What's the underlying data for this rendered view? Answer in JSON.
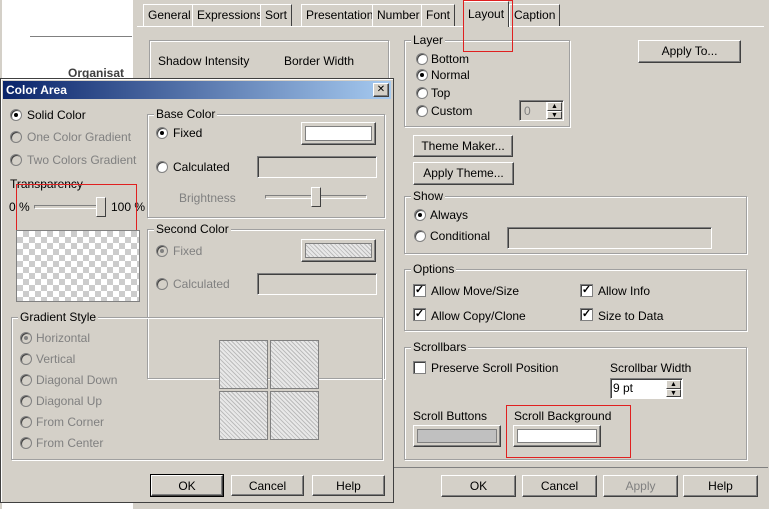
{
  "background_app": {
    "label": "Organisat"
  },
  "main_dialog": {
    "tabs": [
      "General",
      "Expressions",
      "Sort",
      "Presentation",
      "Number",
      "Font",
      "Layout",
      "Caption"
    ],
    "active_tab": "Layout",
    "partial_left": {
      "shadow_intensity_label": "Shadow Intensity",
      "border_width_label": "Border Width"
    },
    "layer": {
      "title": "Layer",
      "options": [
        "Bottom",
        "Normal",
        "Top",
        "Custom"
      ],
      "selected": "Normal",
      "custom_value": "0"
    },
    "apply_to_button": "Apply To...",
    "theme_maker_button": "Theme Maker...",
    "apply_theme_button": "Apply Theme...",
    "show": {
      "title": "Show",
      "options": [
        "Always",
        "Conditional"
      ],
      "selected": "Always"
    },
    "options": {
      "title": "Options",
      "allow_move_size": "Allow Move/Size",
      "allow_info": "Allow Info",
      "allow_copy_clone": "Allow Copy/Clone",
      "size_to_data": "Size to Data",
      "check_mark": "✓"
    },
    "scrollbars": {
      "title": "Scrollbars",
      "preserve_scroll_position": "Preserve Scroll Position",
      "scrollbar_width_label": "Scrollbar Width",
      "scrollbar_width_value": "9 pt",
      "scroll_buttons_label": "Scroll Buttons",
      "scroll_background_label": "Scroll Background"
    },
    "buttons": {
      "ok": "OK",
      "cancel": "Cancel",
      "apply": "Apply",
      "help": "Help"
    }
  },
  "color_area_dialog": {
    "title": "Color Area",
    "close_glyph": "✕",
    "fill_modes": [
      "Solid Color",
      "One Color Gradient",
      "Two Colors Gradient"
    ],
    "selected_fill_mode": "Solid Color",
    "transparency": {
      "label": "Transparency",
      "min_label": "0 %",
      "max_label": "100 %",
      "value_fraction": 0.97
    },
    "base_color": {
      "title": "Base Color",
      "fixed": "Fixed",
      "calculated": "Calculated",
      "brightness": "Brightness",
      "selected": "Fixed",
      "swatch_color": "#ffffff",
      "brightness_fraction": 0.5
    },
    "second_color": {
      "title": "Second Color",
      "fixed": "Fixed",
      "calculated": "Calculated"
    },
    "gradient_style": {
      "title": "Gradient Style",
      "options": [
        "Horizontal",
        "Vertical",
        "Diagonal Down",
        "Diagonal Up",
        "From Corner",
        "From Center"
      ],
      "selected": "Horizontal"
    },
    "buttons": {
      "ok": "OK",
      "cancel": "Cancel",
      "help": "Help"
    }
  },
  "colors": {
    "dialog_face": "#d4d0c8",
    "title_bar": "#0a246a",
    "highlight_red": "#e02020"
  }
}
